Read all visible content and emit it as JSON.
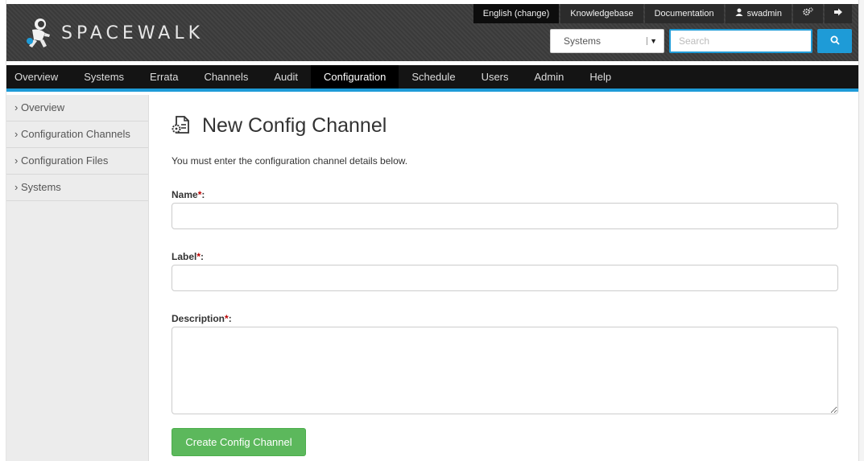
{
  "brand": {
    "name": "SPACEWALK"
  },
  "toplinks": {
    "language": "English (change)",
    "knowledgebase": "Knowledgebase",
    "documentation": "Documentation",
    "user": "swadmin"
  },
  "search": {
    "scope": "Systems",
    "placeholder": "Search"
  },
  "nav": [
    "Overview",
    "Systems",
    "Errata",
    "Channels",
    "Audit",
    "Configuration",
    "Schedule",
    "Users",
    "Admin",
    "Help"
  ],
  "nav_active": "Configuration",
  "sidebar": {
    "items": [
      {
        "label": "Overview"
      },
      {
        "label": "Configuration Channels"
      },
      {
        "label": "Configuration Files"
      },
      {
        "label": "Systems"
      }
    ]
  },
  "page": {
    "title": "New Config Channel",
    "intro": "You must enter the configuration channel details below."
  },
  "form": {
    "name_label": "Name",
    "label_label": "Label",
    "description_label": "Description",
    "required_mark": "*",
    "colon": ":",
    "name_value": "",
    "label_value": "",
    "description_value": "",
    "submit_label": "Create Config Channel"
  },
  "colors": {
    "accent": "#1e9bd7",
    "submit": "#5cb85c",
    "nav_bg": "#141414"
  }
}
